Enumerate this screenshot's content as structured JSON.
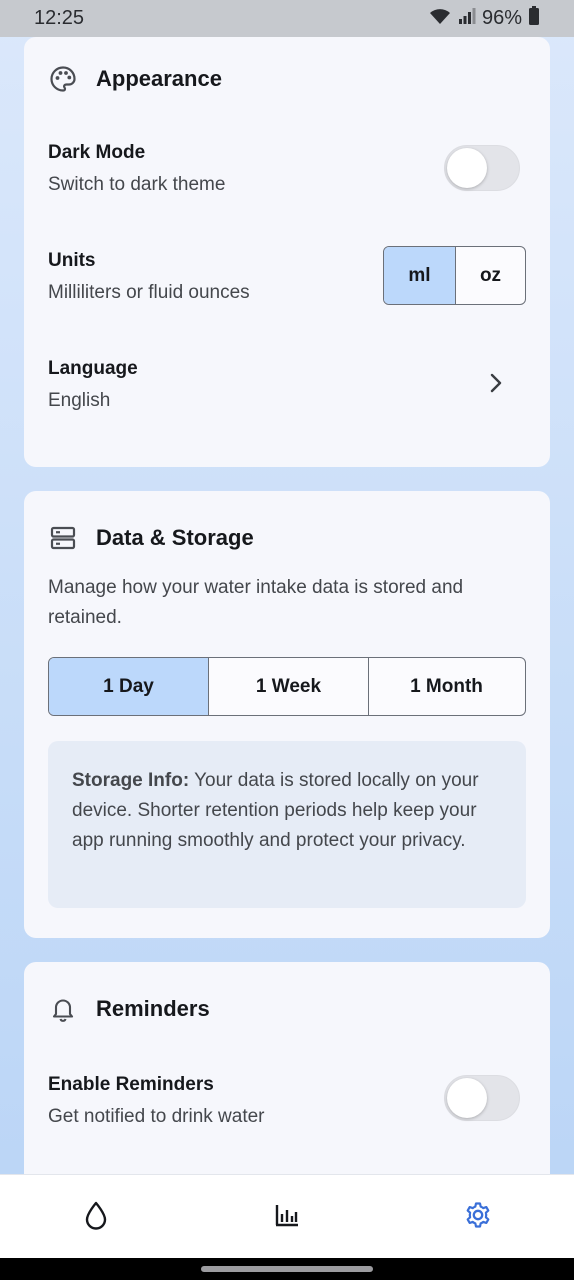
{
  "status_bar": {
    "time": "12:25",
    "battery": "96%"
  },
  "appearance": {
    "title": "Appearance",
    "dark_mode": {
      "title": "Dark Mode",
      "subtitle": "Switch to dark theme",
      "enabled": false
    },
    "units": {
      "title": "Units",
      "subtitle": "Milliliters or fluid ounces",
      "options": [
        "ml",
        "oz"
      ],
      "selected": "ml"
    },
    "language": {
      "title": "Language",
      "value": "English"
    }
  },
  "data_storage": {
    "title": "Data & Storage",
    "description": "Manage how your water intake data is stored and retained.",
    "retention_options": [
      "1 Day",
      "1 Week",
      "1 Month"
    ],
    "selected": "1 Day",
    "info_label": "Storage Info:",
    "info_text": " Your data is stored locally on your device. Shorter retention periods help keep your app running smoothly and protect your privacy."
  },
  "reminders": {
    "title": "Reminders",
    "enable": {
      "title": "Enable Reminders",
      "subtitle": "Get notified to drink water",
      "enabled": false
    }
  },
  "bottom_nav": {
    "items": [
      "water-drop-icon",
      "bar-chart-icon",
      "settings-gear-icon"
    ],
    "active": "settings-gear-icon"
  },
  "colors": {
    "accent": "#3a6fd8",
    "selected_segment": "#bcd8fb",
    "card": "#f6f7fc"
  }
}
